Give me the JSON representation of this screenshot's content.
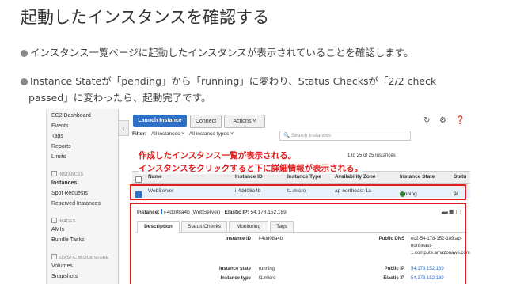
{
  "slide": {
    "title": "起動したインスタンスを確認する",
    "bullet1": "インスタンス一覧ページに起動したインスタンスが表示されていることを確認します。",
    "bullet2_line1": "Instance Stateが「pending」から「running」に変わり、Status Checksが「2/2 check",
    "bullet2_line2": "passed」に変わったら、起動完了です。"
  },
  "sidebar": {
    "items": [
      "EC2 Dashboard",
      "Events",
      "Tags",
      "Reports",
      "Limits"
    ],
    "section_instances": "INSTANCES",
    "instances_items": [
      "Instances",
      "Spot Requests",
      "Reserved Instances"
    ],
    "section_images": "IMAGES",
    "images_items": [
      "AMIs",
      "Bundle Tasks"
    ],
    "section_ebs": "ELASTIC BLOCK STORE",
    "ebs_items": [
      "Volumes",
      "Snapshots"
    ]
  },
  "toolbar": {
    "launch": "Launch Instance",
    "connect": "Connect",
    "actions": "Actions ˅",
    "refresh_icon": "↻",
    "gear_icon": "⚙",
    "help_icon": "❓"
  },
  "filter": {
    "label": "Filter:",
    "instances": "All instances ˅",
    "types": "All instance types ˅",
    "search_placeholder": "Search Instances",
    "pager": "1 to 25 of 25 Instances"
  },
  "table": {
    "headers": [
      "Name",
      "Instance ID",
      "Instance Type",
      "Availability Zone",
      "Instance State",
      "Statu"
    ],
    "row": {
      "name": "WebServer",
      "id": "i-4dd08a4b",
      "type": "t1.micro",
      "az": "ap-northeast-1a",
      "state": "running",
      "status": "2/"
    }
  },
  "details": {
    "instance_label": "Instance:",
    "instance_value": "i-4dd08a4b (WebServer)",
    "eip_label": "Elastic IP:",
    "eip_value": "54.178.152.189",
    "tabs": [
      "Description",
      "Status Checks",
      "Monitoring",
      "Tags"
    ],
    "fields": {
      "instance_id_k": "Instance ID",
      "instance_id_v": "i-4dd08a4b",
      "instance_state_k": "Instance state",
      "instance_state_v": "running",
      "instance_type_k": "Instance type",
      "instance_type_v": "t1.micro",
      "public_dns_k": "Public DNS",
      "public_dns_v1": "ec2-54-178-152-189.ap-",
      "public_dns_v2": "northeast-",
      "public_dns_v3": "1.compute.amazonaws.com",
      "public_ip_k": "Public IP",
      "public_ip_v": "54.178.152.189",
      "elastic_ip_k": "Elastic IP",
      "elastic_ip_v": "54.178.152.189"
    }
  },
  "annotations": {
    "line1": "作成したインスタンス一覧が表示される。",
    "line2": "インスタンスをクリックすると下に詳細情報が表示される。",
    "color": "#e01e1e"
  }
}
